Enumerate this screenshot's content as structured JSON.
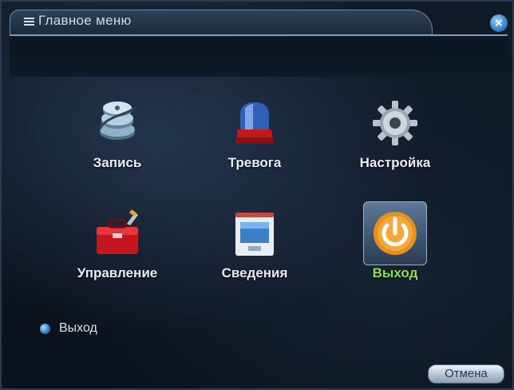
{
  "window": {
    "title": "Главное меню",
    "close_label": "×"
  },
  "menu": {
    "items": [
      {
        "label": "Запись",
        "icon": "record-reel-icon",
        "selected": false
      },
      {
        "label": "Тревога",
        "icon": "alarm-siren-icon",
        "selected": false
      },
      {
        "label": "Настройка",
        "icon": "gear-icon",
        "selected": false
      },
      {
        "label": "Управление",
        "icon": "toolbox-icon",
        "selected": false
      },
      {
        "label": "Сведения",
        "icon": "monitor-info-icon",
        "selected": false
      },
      {
        "label": "Выход",
        "icon": "power-icon",
        "selected": true
      }
    ]
  },
  "status": {
    "text": "Выход"
  },
  "footer": {
    "cancel_label": "Отмена"
  },
  "colors": {
    "selected_label": "#8ee34a",
    "label": "#e8eef5",
    "background": "#0d1520",
    "accent_blue": "#3d86d1"
  }
}
